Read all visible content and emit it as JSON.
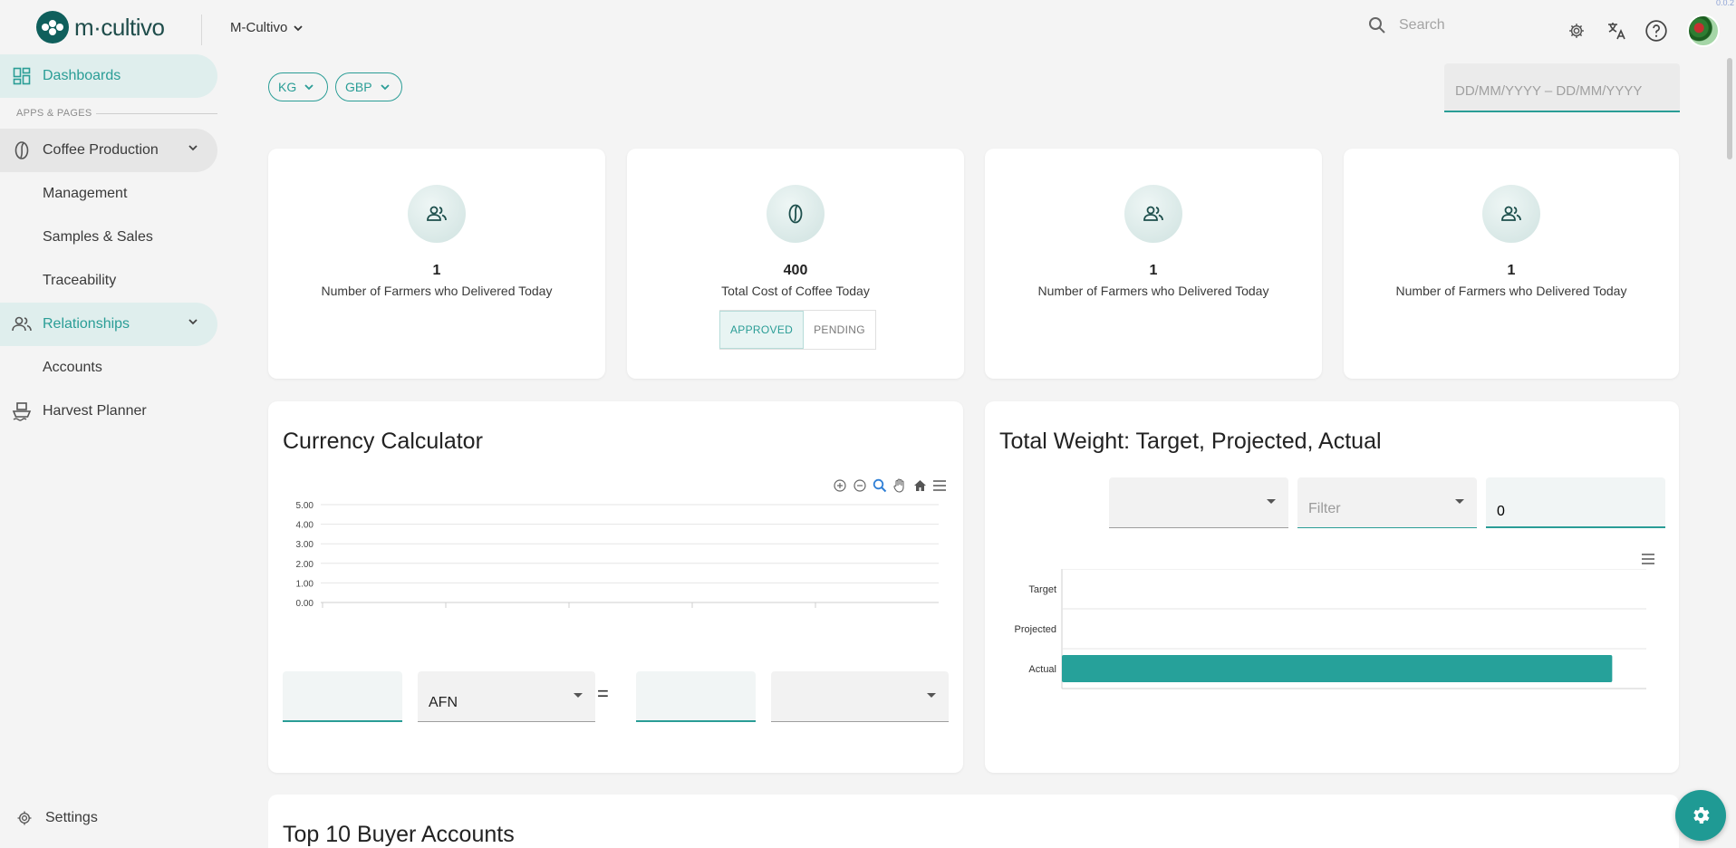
{
  "app": {
    "logo_text": "m·cultivo",
    "org_selector": "M-Cultivo",
    "version": "0.0.2",
    "search_placeholder": "Search"
  },
  "sidebar": {
    "dashboards": "Dashboards",
    "section_label": "APPS & PAGES",
    "coffee_production": "Coffee Production",
    "coffee_children": [
      "Management",
      "Samples & Sales",
      "Traceability"
    ],
    "relationships": "Relationships",
    "relationships_children": [
      "Accounts"
    ],
    "harvest_planner": "Harvest Planner",
    "settings": "Settings"
  },
  "filters": {
    "unit": "KG",
    "currency": "GBP",
    "date_placeholder": "DD/MM/YYYY – DD/MM/YYYY"
  },
  "stats": [
    {
      "icon": "farmers-icon",
      "value": "1",
      "label": "Number of Farmers who Delivered Today"
    },
    {
      "icon": "coffee-bean-icon",
      "value": "400",
      "label": "Total Cost of Coffee Today",
      "toggle": [
        "APPROVED",
        "PENDING"
      ],
      "toggle_selected": "APPROVED"
    },
    {
      "icon": "farmers-icon",
      "value": "1",
      "label": "Number of Farmers who Delivered Today"
    },
    {
      "icon": "farmers-icon",
      "value": "1",
      "label": "Number of Farmers who Delivered Today"
    }
  ],
  "currency_calculator": {
    "title": "Currency Calculator",
    "from_amount": "",
    "from_currency": "AFN",
    "equals": "=",
    "to_amount": "",
    "to_currency": ""
  },
  "total_weight": {
    "title": "Total Weight: Target, Projected, Actual",
    "select1": "",
    "filter_placeholder": "Filter",
    "number_value": "0"
  },
  "top_buyers": {
    "title": "Top 10 Buyer Accounts"
  },
  "colors": {
    "accent": "#2a9d96",
    "bar": "#26a19a"
  },
  "chart_data": [
    {
      "type": "line",
      "title": "",
      "y_ticks": [
        "5.00",
        "4.00",
        "3.00",
        "2.00",
        "1.00",
        "0.00"
      ],
      "ylim": [
        0,
        5
      ],
      "series": [],
      "grid": true
    },
    {
      "type": "bar",
      "orientation": "horizontal",
      "categories": [
        "Target",
        "Projected",
        "Actual"
      ],
      "values": [
        0,
        0,
        565
      ],
      "x_ticks": [
        "0",
        "100",
        "200",
        "300",
        "400",
        "500",
        "600"
      ],
      "xlim": [
        0,
        600
      ],
      "grid": true
    }
  ]
}
